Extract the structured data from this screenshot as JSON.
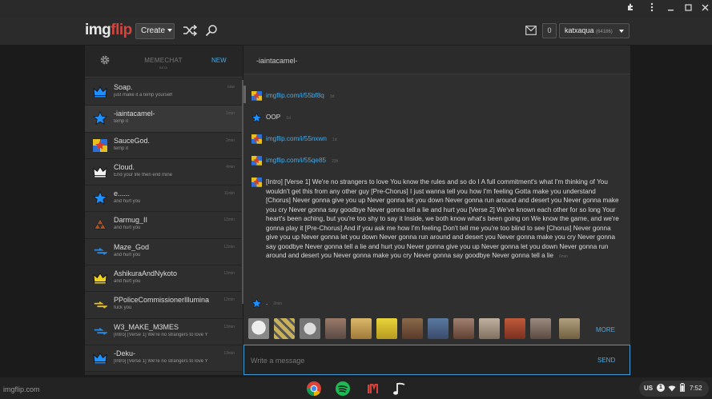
{
  "site": {
    "logo_part1": "img",
    "logo_part2": "flip",
    "create_label": "Create",
    "notification_count": "0",
    "username": "katxaqua",
    "user_points": "(64186)",
    "accent": "#4aa9e3",
    "brand_red": "#d9433b"
  },
  "sidebar": {
    "title": "MEMECHAT",
    "beta": "BETA",
    "new_label": "NEW",
    "chats": [
      {
        "name": "Soap.",
        "preview": "just make it a temp yourself",
        "time": "now",
        "avatar": "crown-blue"
      },
      {
        "name": "-iaintacamel-",
        "preview": "temp it",
        "time": "1min",
        "avatar": "star-blue"
      },
      {
        "name": "SauceGod.",
        "preview": "temp it",
        "time": "2min",
        "avatar": "rainbow-square"
      },
      {
        "name": "Cloud.",
        "preview": "End your life then end mine",
        "time": "4min",
        "avatar": "crown-white"
      },
      {
        "name": "e......",
        "preview": "and hurt you",
        "time": "11min",
        "avatar": "star-blue"
      },
      {
        "name": "Darmug_II",
        "preview": "and hurt you",
        "time": "12min",
        "avatar": "triforce-dark"
      },
      {
        "name": "Maze_God",
        "preview": "and hurt you",
        "time": "12min",
        "avatar": "dash-blue"
      },
      {
        "name": "AshikuraAndNykoto",
        "preview": "and hurt you",
        "time": "12min",
        "avatar": "crown-yellow"
      },
      {
        "name": "PPoliceCommissionerIllumina",
        "preview": "fuck you",
        "time": "12min",
        "avatar": "dash-yellow"
      },
      {
        "name": "W3_MAKE_M3MES",
        "preview": "[Intro] [Verse 1] We're no strangers to love Y",
        "time": "13min",
        "avatar": "dash-blue"
      },
      {
        "name": "-Deku-",
        "preview": "[Intro] [Verse 1] We're no strangers to love Y",
        "time": "13min",
        "avatar": "crown-blue"
      }
    ]
  },
  "conversation": {
    "title": "-iaintacamel-",
    "messages": [
      {
        "text": "imgflip.com/i/55bf8q",
        "time": "3d",
        "link": true,
        "avatar": "rainbow-square"
      },
      {
        "text": "OOP",
        "time": "1d",
        "link": false,
        "avatar": "star-blue"
      },
      {
        "text": "imgflip.com/i/55nxwn",
        "time": "1d",
        "link": true,
        "avatar": "rainbow-square"
      },
      {
        "text": "imgflip.com/i/55qe85",
        "time": "23h",
        "link": true,
        "avatar": "rainbow-square"
      },
      {
        "text": "[Intro] [Verse 1] We're no strangers to love You know the rules and so do I A full commitment's what I'm thinking of You wouldn't get this from any other guy [Pre-Chorus] I just wanna tell you how I'm feeling Gotta make you understand [Chorus] Never gonna give you up Never gonna let you down Never gonna run around and desert you Never gonna make you cry Never gonna say goodbye Never gonna tell a lie and hurt you [Verse 2] We've known each other for so long Your heart's been aching, but you're too shy to say it Inside, we both know what's been going on We know the game, and we're gonna play it [Pre-Chorus] And if you ask me how I'm feeling Don't tell me you're too blind to see [Chorus] Never gonna give you up Never gonna let you down Never gonna run around and desert you Never gonna make you cry Never gonna say goodbye Never gonna tell a lie and hurt you Never gonna give you up Never gonna let you down Never gonna run around and desert you Never gonna make you cry Never gonna say goodbye Never gonna tell a lie",
        "time": "6min",
        "link": false,
        "avatar": "rainbow-square"
      },
      {
        "text": ".",
        "time": "2min",
        "link": false,
        "avatar": "star-blue"
      }
    ],
    "more_label": "MORE",
    "input_placeholder": "Write a message",
    "send_label": "SEND"
  },
  "shelf": {
    "url": "imgflip.com",
    "lang": "US",
    "badge": "1",
    "time": "7:52"
  }
}
